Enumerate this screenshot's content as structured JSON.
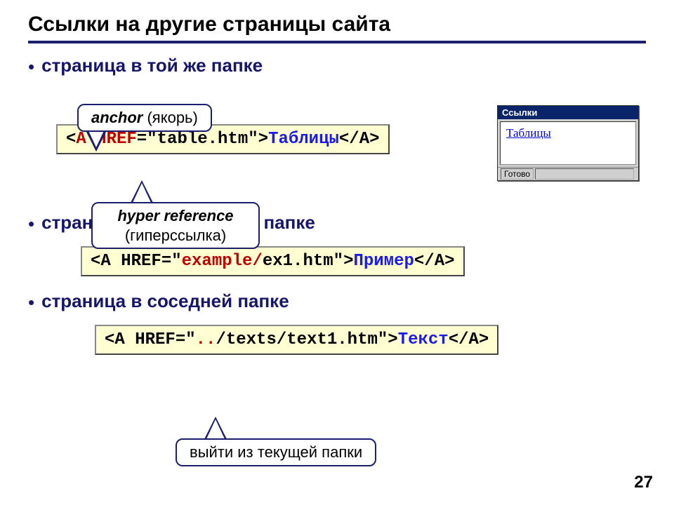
{
  "title": "Ссылки на другие страницы сайта",
  "bullets": {
    "b1": "страница в той же папке",
    "b2": "страница во вложенной папке",
    "b3": "страница в соседней папке"
  },
  "code1": {
    "p1": "<",
    "tagA": "A",
    "sp1": " ",
    "href": "HREF",
    "p2": "=\"table.htm\">",
    "linktext": "Таблицы",
    "p3": "</A>"
  },
  "code2": {
    "p1": "<A HREF=\"",
    "folder": "example/",
    "p2": "ex1.htm\">",
    "linktext": "Пример",
    "p3": "</A>"
  },
  "code3": {
    "p1": "<A HREF=\"",
    "dots": "..",
    "p2": "/texts/text1.htm\">",
    "linktext": "Текст",
    "p3": "</A>"
  },
  "callouts": {
    "anchor_em": "anchor",
    "anchor_rest": " (якорь)",
    "href_em": "hyper reference",
    "href_rest": "(гиперссылка)",
    "exit": "выйти из текущей папки"
  },
  "browser": {
    "title": "Ссылки",
    "link": "Таблицы",
    "status": "Готово"
  },
  "pagenum": "27"
}
